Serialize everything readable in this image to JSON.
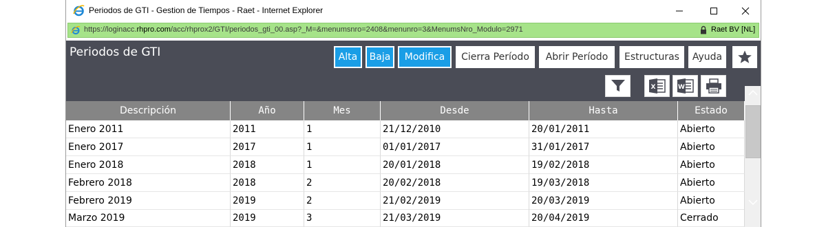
{
  "window": {
    "title": "Periodos de GTI - Gestion de Tiempos - Raet - Internet Explorer"
  },
  "address": {
    "url_prefix": "https://loginacc.",
    "url_domain": "rhpro.com",
    "url_rest": "/acc/rhprox2/GTI/periodos_gti_00.asp?_M=&menumsnro=2408&menunro=3&MenumsNro_Modulo=2971",
    "certificate": "Raet BV [NL]"
  },
  "page": {
    "title": "Periodos de GTI"
  },
  "toolbar": {
    "alta": "Alta",
    "baja": "Baja",
    "modifica": "Modifica",
    "cierra": "Cierra Período",
    "abrir": "Abrir Período",
    "estructuras": "Estructuras",
    "ayuda": "Ayuda"
  },
  "icons": {
    "favorite": "star-icon",
    "filter": "filter-icon",
    "excel": "excel-export-icon",
    "word": "word-export-icon",
    "print": "print-icon"
  },
  "colors": {
    "header_bg": "#4a4c56",
    "button_blue": "#1a9ee6",
    "table_header": "#858585",
    "address_bar": "#a6e389"
  },
  "table": {
    "headers": [
      "Descripción",
      "Año",
      "Mes",
      "Desde",
      "Hasta",
      "Estado"
    ],
    "rows": [
      [
        "Enero 2011",
        "2011",
        "1",
        "21/12/2010",
        "20/01/2011",
        "Abierto"
      ],
      [
        "Enero 2017",
        "2017",
        "1",
        "01/01/2017",
        "31/01/2017",
        "Abierto"
      ],
      [
        "Enero 2018",
        "2018",
        "1",
        "20/01/2018",
        "19/02/2018",
        "Abierto"
      ],
      [
        "Febrero 2018",
        "2018",
        "2",
        "20/02/2018",
        "19/03/2018",
        "Abierto"
      ],
      [
        "Febrero 2019",
        "2019",
        "2",
        "21/02/2019",
        "20/03/2019",
        "Abierto"
      ],
      [
        "Marzo 2019",
        "2019",
        "3",
        "21/03/2019",
        "20/04/2019",
        "Cerrado"
      ]
    ]
  }
}
